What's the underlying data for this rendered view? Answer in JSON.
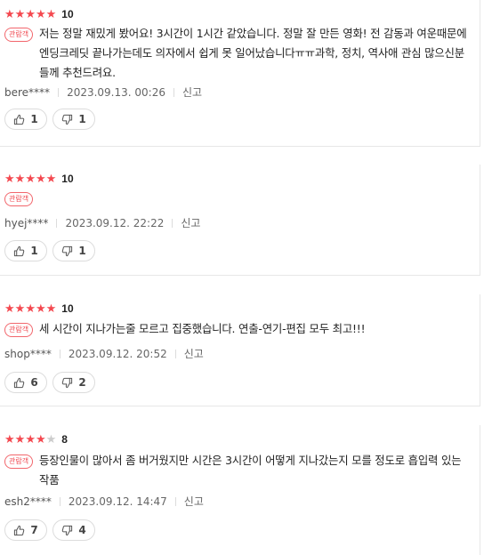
{
  "reviews": [
    {
      "stars_filled": 5,
      "score": "10",
      "badge": "관람객",
      "text": "저는 정말 재밌게 봤어요! 3시간이 1시간 같았습니다. 정말 잘 만든 영화! 전 감동과 여운때문에 엔딩크레딧 끝나가는데도 의자에서 쉽게 못 일어났습니다ㅠㅠ과학, 정치, 역사애 관심 많으신분들께 추천드려요.",
      "user": "bere****",
      "date": "2023.09.13. 00:26",
      "report": "신고",
      "likes": "1",
      "dislikes": "1"
    },
    {
      "stars_filled": 5,
      "score": "10",
      "badge": "관람객",
      "text": "",
      "user": "hyej****",
      "date": "2023.09.12. 22:22",
      "report": "신고",
      "likes": "1",
      "dislikes": "1"
    },
    {
      "stars_filled": 5,
      "score": "10",
      "badge": "관람객",
      "text": "세 시간이 지나가는줄 모르고 집중했습니다. 연출-연기-편집 모두 최고!!!",
      "user": "shop****",
      "date": "2023.09.12. 20:52",
      "report": "신고",
      "likes": "6",
      "dislikes": "2"
    },
    {
      "stars_filled": 4,
      "score": "8",
      "badge": "관람객",
      "text": "등장인물이 많아서 좀 버거웠지만 시간은 3시간이 어떻게 지나갔는지 모를 정도로 흡입력 있는 작품",
      "user": "esh2****",
      "date": "2023.09.12. 14:47",
      "report": "신고",
      "likes": "7",
      "dislikes": "4"
    }
  ],
  "colors": {
    "star_on": "#f4484f",
    "star_off": "#cccccc",
    "badge": "#f04a52"
  },
  "icons": {
    "like": "thumbs-up-icon",
    "dislike": "thumbs-down-icon",
    "star": "star-icon"
  }
}
